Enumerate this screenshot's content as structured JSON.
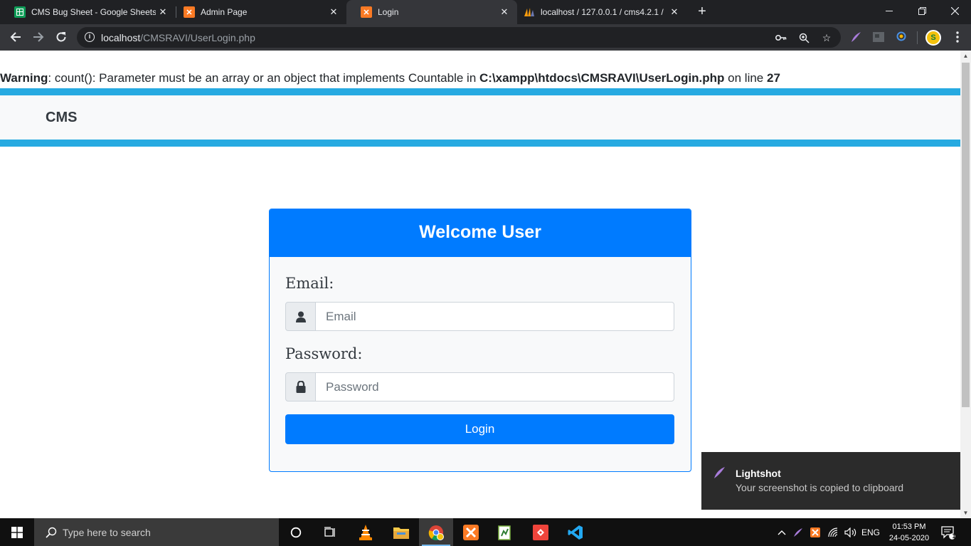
{
  "browser": {
    "tabs": [
      {
        "title": "CMS Bug Sheet - Google Sheets",
        "icon": "google-sheets-icon",
        "color": "#0f9d58",
        "active": false
      },
      {
        "title": "Admin Page",
        "icon": "xampp-icon",
        "color": "#fb7a24",
        "active": false
      },
      {
        "title": "Login",
        "icon": "xampp-icon",
        "color": "#fb7a24",
        "active": true
      },
      {
        "title": "localhost / 127.0.0.1 / cms4.2.1 /",
        "icon": "phpmyadmin-icon",
        "color": "#f89c0e",
        "active": false
      }
    ],
    "url_host": "localhost",
    "url_path": "/CMSRAVI/UserLogin.php"
  },
  "warning": {
    "label": "Warning",
    "text_a": ": count(): Parameter must be an array or an object that implements Countable in ",
    "file": "C:\\xampp\\htdocs\\CMSRAVI\\UserLogin.php",
    "text_b": " on line ",
    "line": "27"
  },
  "navbar": {
    "brand": "CMS"
  },
  "login_card": {
    "title": "Welcome User",
    "email_label": "Email:",
    "email_placeholder": "Email",
    "password_label": "Password:",
    "password_placeholder": "Password",
    "login_button": "Login"
  },
  "toast": {
    "title": "Lightshot",
    "message": "Your screenshot is copied to clipboard"
  },
  "taskbar": {
    "search_placeholder": "Type here to search",
    "language": "ENG",
    "time": "01:53 PM",
    "date": "24-05-2020",
    "notification_count": "1"
  },
  "colors": {
    "primary": "#007bff",
    "accent_band": "#27aae1"
  }
}
